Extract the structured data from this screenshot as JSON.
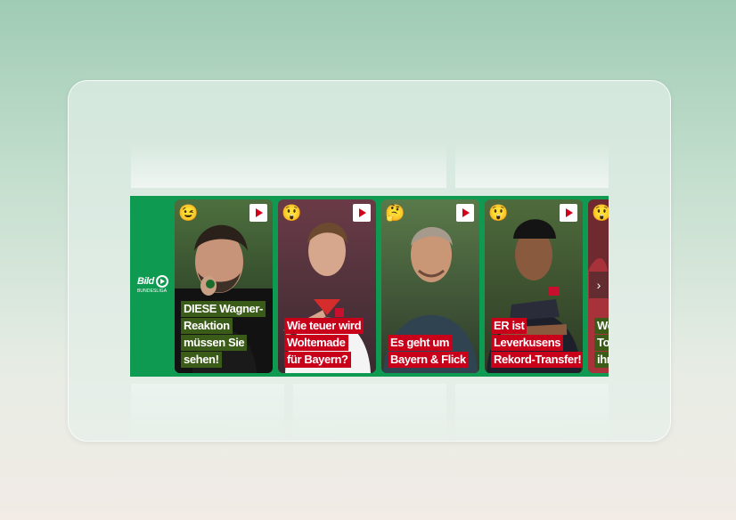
{
  "brand": {
    "logo_word": "Bild",
    "logo_sub": "BUNDESLIGA",
    "accent": "#0f9a52"
  },
  "tiles": [
    {
      "emoji": "😉",
      "caption": [
        "DIESE Wagner-",
        "Reaktion",
        "müssen Sie",
        "sehen!"
      ],
      "caption_color": "#3b5b18",
      "play_icon": "play-icon"
    },
    {
      "emoji": "😲",
      "caption": [
        "Wie teuer wird",
        "Woltemade",
        "für Bayern?"
      ],
      "caption_color": "#c8001a",
      "play_icon": "play-icon"
    },
    {
      "emoji": "🤔",
      "caption": [
        "Es geht um",
        "Bayern & Flick"
      ],
      "caption_color": "#c8001a",
      "play_icon": "play-icon"
    },
    {
      "emoji": "😲",
      "caption": [
        "ER ist",
        "Leverkusens",
        "Rekord-Transfer!"
      ],
      "caption_color": "#c8001a",
      "play_icon": "play-icon"
    },
    {
      "emoji": "😲",
      "caption": [
        "We",
        "Tor",
        "ihr"
      ],
      "caption_color": "#3b5b18",
      "play_icon": "play-icon"
    }
  ],
  "nav": {
    "next_icon": "chevron-right-icon",
    "next_glyph": "›"
  }
}
